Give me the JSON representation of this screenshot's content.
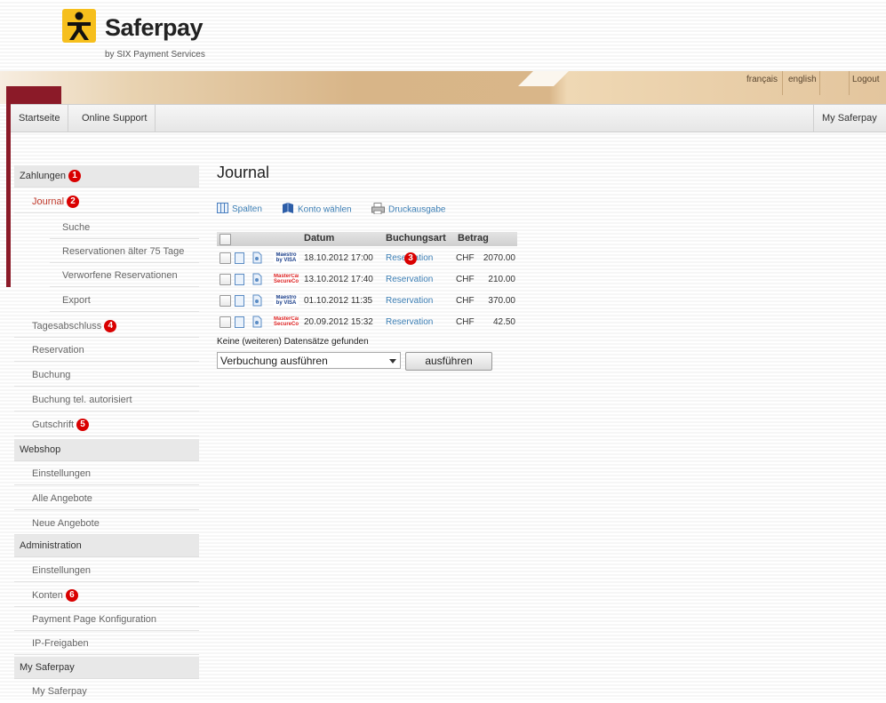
{
  "brand": {
    "name": "Saferpay",
    "tagline": "by SIX Payment Services",
    "color": "#f6bf1d"
  },
  "header": {
    "languages": [
      "français",
      "english"
    ],
    "logout": "Logout"
  },
  "topnav": {
    "items": [
      "Startseite",
      "Online Support"
    ],
    "right": "My Saferpay"
  },
  "sidebar": {
    "zahlungen": {
      "label": "Zahlungen",
      "badge": "1"
    },
    "journal": {
      "label": "Journal",
      "badge": "2"
    },
    "journal_sub": [
      "Suche",
      "Reservationen älter 75 Tage",
      "Verworfene Reservationen",
      "Export"
    ],
    "tagesabschluss": {
      "label": "Tagesabschluss",
      "badge": "4"
    },
    "zahl_items": [
      "Reservation",
      "Buchung",
      "Buchung tel. autorisiert"
    ],
    "gutschrift": {
      "label": "Gutschrift",
      "badge": "5"
    },
    "webshop": {
      "label": "Webshop",
      "items": [
        "Einstellungen",
        "Alle Angebote",
        "Neue Angebote"
      ]
    },
    "administration": {
      "label": "Administration",
      "item0": "Einstellungen"
    },
    "konten": {
      "label": "Konten",
      "badge": "6"
    },
    "admin_items": [
      "Payment Page Konfiguration",
      "IP-Freigaben"
    ],
    "mysaferpay": {
      "label": "My Saferpay",
      "item": "My Saferpay"
    }
  },
  "main": {
    "title": "Journal",
    "toolbar": {
      "spalten": "Spalten",
      "konto": "Konto wählen",
      "druck": "Druckausgabe"
    },
    "columns": {
      "datum": "Datum",
      "buchungsart": "Buchungsart",
      "betrag": "Betrag"
    },
    "rows": [
      {
        "card": "Maestro by VISA",
        "date": "18.10.2012 17:00",
        "type": "Reservation",
        "currency": "CHF",
        "amount": "2070.00"
      },
      {
        "card": "MasterCard SecureCode",
        "date": "13.10.2012 17:40",
        "type": "Reservation",
        "currency": "CHF",
        "amount": "210.00"
      },
      {
        "card": "Maestro by VISA",
        "date": "01.10.2012 11:35",
        "type": "Reservation",
        "currency": "CHF",
        "amount": "370.00"
      },
      {
        "card": "MasterCard SecureCode",
        "date": "20.09.2012 15:32",
        "type": "Reservation",
        "currency": "CHF",
        "amount": "42.50"
      }
    ],
    "row_badge": "3",
    "note": "Keine (weiteren) Datensätze gefunden",
    "select_value": "Verbuchung ausführen",
    "button": "ausführen"
  },
  "colors": {
    "maroon": "#8b1a28",
    "link": "#3d7fb5",
    "badge": "#d90000",
    "tan": "#d8b588"
  }
}
